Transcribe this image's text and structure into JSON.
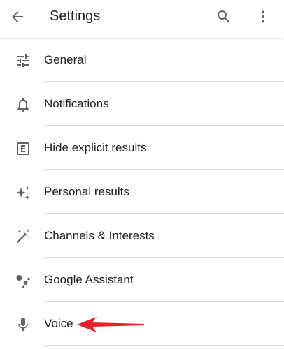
{
  "appbar": {
    "title": "Settings",
    "icons": {
      "back": "arrow-back-icon",
      "search": "search-icon",
      "more": "more-vert-icon"
    }
  },
  "settings": {
    "items": [
      {
        "label": "General",
        "icon": "tune-sliders-icon"
      },
      {
        "label": "Notifications",
        "icon": "bell-icon"
      },
      {
        "label": "Hide explicit results",
        "icon": "explicit-icon"
      },
      {
        "label": "Personal results",
        "icon": "sparkle-icon"
      },
      {
        "label": "Channels & Interests",
        "icon": "magic-wand-icon"
      },
      {
        "label": "Google Assistant",
        "icon": "assistant-dots-icon"
      },
      {
        "label": "Voice",
        "icon": "microphone-icon"
      }
    ]
  },
  "annotation": {
    "arrow_color": "#e8202a"
  },
  "colors": {
    "icon": "#5f6368",
    "text": "#202124",
    "divider": "#dadce0"
  }
}
